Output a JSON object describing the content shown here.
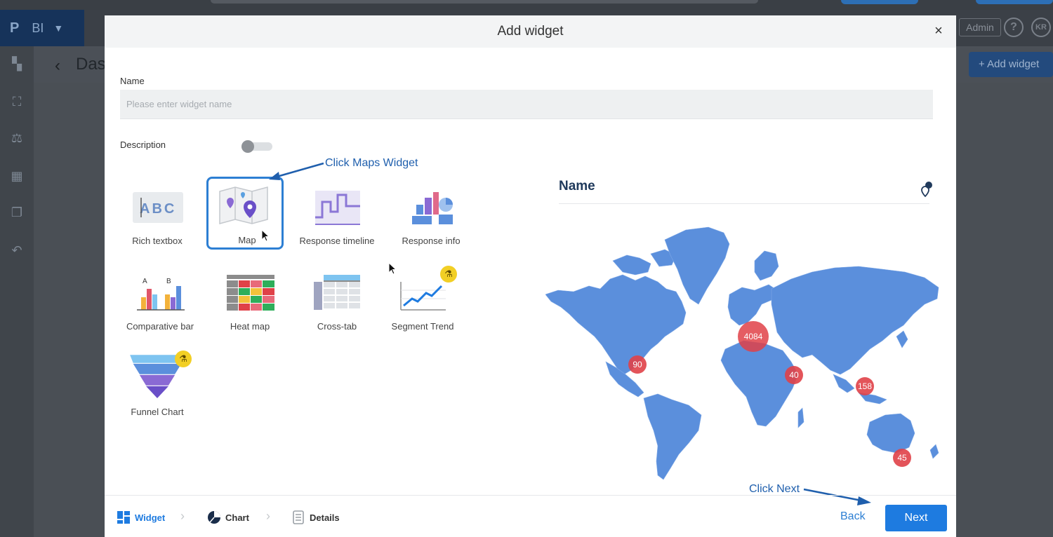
{
  "app": {
    "brand_letter": "P",
    "brand_name": "BI",
    "page_title": "Das",
    "admin_label": "Admin",
    "help_label": "?",
    "avatar_initials": "KR",
    "add_widget_button": "+ Add widget"
  },
  "modal": {
    "title": "Add widget",
    "close_icon": "×",
    "name_label": "Name",
    "name_placeholder": "Please enter widget name",
    "name_value": "",
    "description_label": "Description",
    "description_toggle_on": false
  },
  "widgets": [
    {
      "label": "Rich textbox",
      "icon": "rich-textbox-icon"
    },
    {
      "label": "Map",
      "icon": "map-icon",
      "selected": true
    },
    {
      "label": "Response timeline",
      "icon": "response-timeline-icon"
    },
    {
      "label": "Response info",
      "icon": "response-info-icon"
    },
    {
      "label": "Comparative bar",
      "icon": "comparative-bar-icon"
    },
    {
      "label": "Heat map",
      "icon": "heat-map-icon"
    },
    {
      "label": "Cross-tab",
      "icon": "cross-tab-icon"
    },
    {
      "label": "Segment Trend",
      "icon": "segment-trend-icon",
      "beta": true
    },
    {
      "label": "Funnel Chart",
      "icon": "funnel-chart-icon",
      "beta": true
    }
  ],
  "annotations": {
    "click_maps": "Click Maps Widget",
    "click_next": "Click Next"
  },
  "preview": {
    "title": "Name",
    "pin_count": "1",
    "map_color": "#5b8fdc",
    "bubble_color": "#e04148",
    "bubbles": [
      {
        "label": "4084"
      },
      {
        "label": "90"
      },
      {
        "label": "40"
      },
      {
        "label": "158"
      },
      {
        "label": "45"
      }
    ]
  },
  "footer": {
    "steps": [
      {
        "label": "Widget",
        "icon": "widget-grid-icon",
        "active": true
      },
      {
        "label": "Chart",
        "icon": "chart-pie-icon"
      },
      {
        "label": "Details",
        "icon": "details-doc-icon"
      }
    ],
    "back_label": "Back",
    "next_label": "Next"
  },
  "colors": {
    "accent": "#1e7be0",
    "selected_border": "#2d7fd3",
    "annotation": "#1f5fad"
  }
}
